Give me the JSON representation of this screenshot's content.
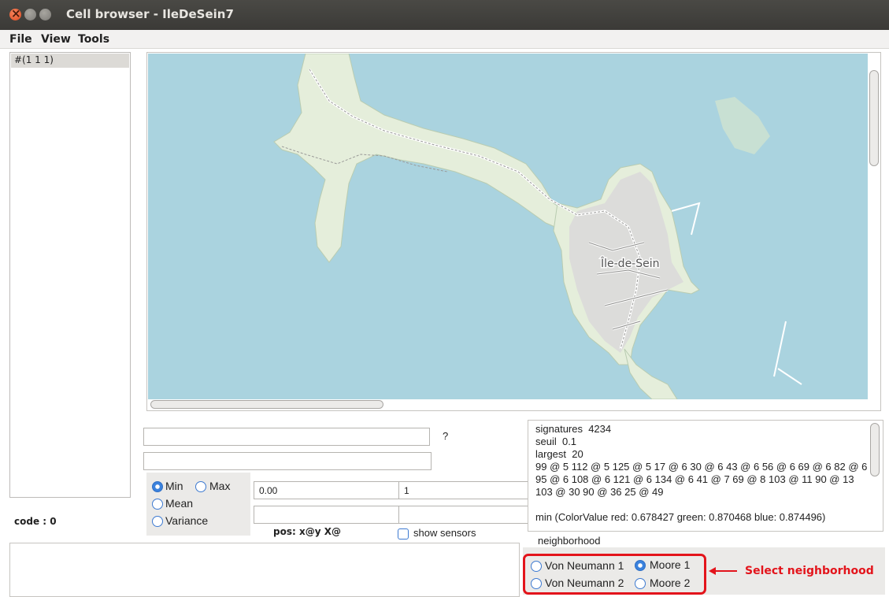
{
  "window": {
    "title": "Cell browser - IleDeSein7"
  },
  "menu": {
    "file": "File",
    "view": "View",
    "tools": "Tools"
  },
  "list": {
    "items": [
      "#(1 1 1)"
    ]
  },
  "map": {
    "place_label": "Île-de-Sein",
    "colors": {
      "water": "#aad3df",
      "land": "#e5eedb",
      "urban": "#d9d9d9",
      "road": "#ffffff"
    }
  },
  "query": {
    "help": "?"
  },
  "stats": {
    "min": "Min",
    "max": "Max",
    "mean": "Mean",
    "variance": "Variance",
    "selected": "min"
  },
  "range": {
    "low": "0.00",
    "high": "1"
  },
  "code_label": "code : 0",
  "pos_label": "pos: x@y X@",
  "show_sensors": "show sensors",
  "output": {
    "text": "signatures  4234\nseuil  0.1\nlargest  20\n99 @ 5 112 @ 5 125 @ 5 17 @ 6 30 @ 6 43 @ 6 56 @ 6 69 @ 6 82 @ 6 95 @ 6 108 @ 6 121 @ 6 134 @ 6 41 @ 7 69 @ 8 103 @ 11 90 @ 13 103 @ 30 90 @ 36 25 @ 49\n\nmin (ColorValue red: 0.678427 green: 0.870468 blue: 0.874496)"
  },
  "neighborhood": {
    "label": "neighborhood",
    "von_neumann_1": "Von Neumann 1",
    "von_neumann_2": "Von Neumann 2",
    "moore_1": "Moore 1",
    "moore_2": "Moore 2",
    "selected": "moore_1"
  },
  "annotation": {
    "text": "Select neighborhood",
    "color": "#e3141b"
  }
}
